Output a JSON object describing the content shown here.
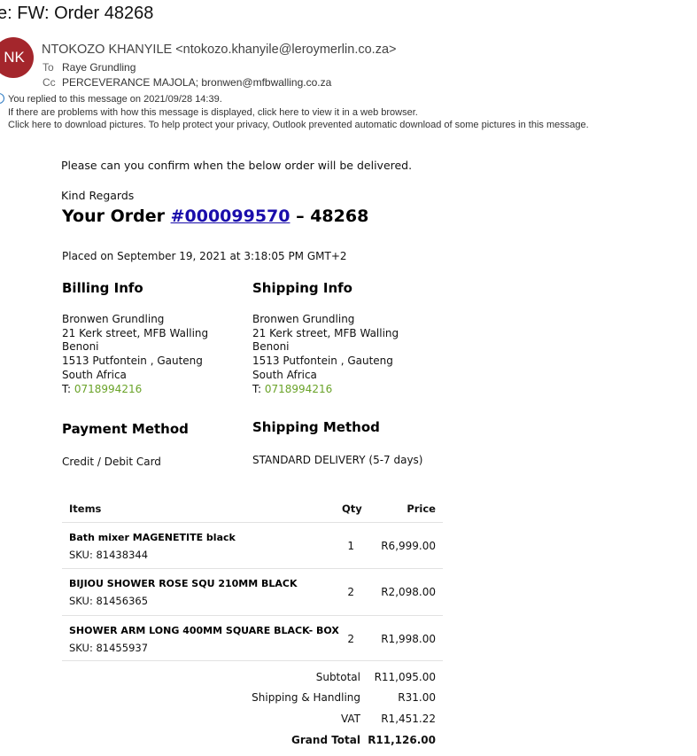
{
  "email": {
    "subject": "e: FW: Order 48268",
    "avatar_initials": "NK",
    "sender": "NTOKOZO KHANYILE <ntokozo.khanyile@leroymerlin.co.za>",
    "to_label": "To",
    "to_value": "Raye Grundling",
    "cc_label": "Cc",
    "cc_value": "PERCEVERANCE MAJOLA; bronwen@mfbwalling.co.za",
    "replied_notice": "You replied to this message on 2021/09/28 14:39.",
    "display_notice": "If there are problems with how this message is displayed, click here to view it in a web browser.",
    "pictures_notice": "Click here to download pictures. To help protect your privacy, Outlook prevented automatic download of some pictures in this message."
  },
  "body": {
    "intro": "Please can you confirm when the below order will be delivered.",
    "regards": "Kind Regards",
    "order_prefix": "Your Order ",
    "order_link": "#000099570",
    "order_suffix": " – 48268",
    "placed_on": "Placed on September 19, 2021 at 3:18:05 PM GMT+2"
  },
  "billing": {
    "title": "Billing Info",
    "name": "Bronwen Grundling",
    "street": "21 Kerk street, MFB Walling",
    "city": "Benoni",
    "postal": "1513 Putfontein , Gauteng",
    "country": "South Africa",
    "phone_label": "T: ",
    "phone": "0718994216"
  },
  "shipping": {
    "title": "Shipping Info",
    "name": "Bronwen Grundling",
    "street": "21 Kerk street, MFB Walling",
    "city": "Benoni",
    "postal": "1513 Putfontein , Gauteng",
    "country": "South Africa",
    "phone_label": "T: ",
    "phone": "0718994216"
  },
  "payment": {
    "title": "Payment Method",
    "value": "Credit / Debit Card"
  },
  "shipping_method": {
    "title": "Shipping Method",
    "value": "STANDARD DELIVERY (5-7 days)"
  },
  "table": {
    "headers": {
      "items": "Items",
      "qty": "Qty",
      "price": "Price"
    },
    "rows": [
      {
        "name": "Bath mixer MAGENETITE black",
        "sku": "SKU: 81438344",
        "qty": "1",
        "price": "R6,999.00"
      },
      {
        "name": "BIJIOU SHOWER ROSE SQU 210MM BLACK",
        "sku": "SKU: 81456365",
        "qty": "2",
        "price": "R2,098.00"
      },
      {
        "name": "SHOWER ARM LONG 400MM SQUARE BLACK- BOX",
        "sku": "SKU: 81455937",
        "qty": "2",
        "price": "R1,998.00"
      }
    ]
  },
  "totals": {
    "subtotal_label": "Subtotal",
    "subtotal": "R11,095.00",
    "shipping_label": "Shipping & Handling",
    "shipping": "R31.00",
    "vat_label": "VAT",
    "vat": "R1,451.22",
    "grand_label": "Grand Total",
    "grand": "R11,126.00"
  },
  "colors": {
    "avatar": "#a4262c",
    "link": "#1a0dab",
    "phone": "#6aa329",
    "info_icon": "#2b79c2"
  }
}
